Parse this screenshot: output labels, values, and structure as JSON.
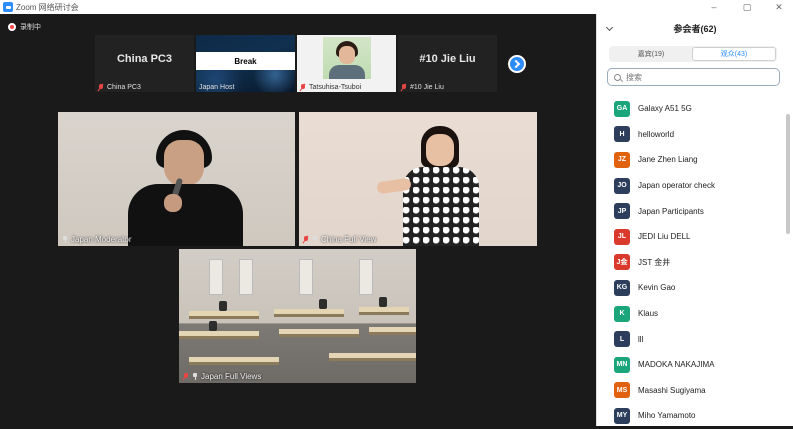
{
  "window": {
    "title": "Zoom 网络研讨会"
  },
  "recording": {
    "label": "录制中"
  },
  "thumbnails": [
    {
      "big": "China PC3",
      "name": "China PC3",
      "kind": "text"
    },
    {
      "big": "Break",
      "name": "Japan Host",
      "kind": "break"
    },
    {
      "big": "",
      "name": "Tatsuhisa-Tsuboi",
      "kind": "photo"
    },
    {
      "big": "#10 Jie Liu",
      "name": "#10 Jie Liu",
      "kind": "text"
    }
  ],
  "tiles": {
    "moderator": "Japan Moderator",
    "china": "China Full View",
    "room": "Japan Full Views"
  },
  "panel": {
    "title": "参会者(62)",
    "tabs": [
      {
        "label": "嘉宾(19)",
        "active": false
      },
      {
        "label": "观众(43)",
        "active": true
      }
    ],
    "search_placeholder": "搜索",
    "participants": [
      {
        "initials": "GA",
        "name": "Galaxy A51 5G",
        "color": "#1aa67a"
      },
      {
        "initials": "H",
        "name": "helloworld",
        "color": "#2c3e5c"
      },
      {
        "initials": "JZ",
        "name": "Jane Zhen Liang",
        "color": "#e0620f"
      },
      {
        "initials": "JO",
        "name": "Japan operator check",
        "color": "#2c3e5c"
      },
      {
        "initials": "JP",
        "name": "Japan Participants",
        "color": "#2c3e5c"
      },
      {
        "initials": "JL",
        "name": "JEDI Liu  DELL",
        "color": "#d93a2b"
      },
      {
        "initials": "J金",
        "name": "JST 金井",
        "color": "#d93a2b"
      },
      {
        "initials": "KG",
        "name": "Kevin Gao",
        "color": "#2c3e5c"
      },
      {
        "initials": "K",
        "name": "Klaus",
        "color": "#1aa67a"
      },
      {
        "initials": "L",
        "name": "lll",
        "color": "#2c3e5c"
      },
      {
        "initials": "MN",
        "name": "MADOKA NAKAJIMA",
        "color": "#1aa67a"
      },
      {
        "initials": "MS",
        "name": "Masashi Sugiyama",
        "color": "#e0620f"
      },
      {
        "initials": "MY",
        "name": "Miho Yamamoto",
        "color": "#2c3e5c"
      }
    ]
  }
}
